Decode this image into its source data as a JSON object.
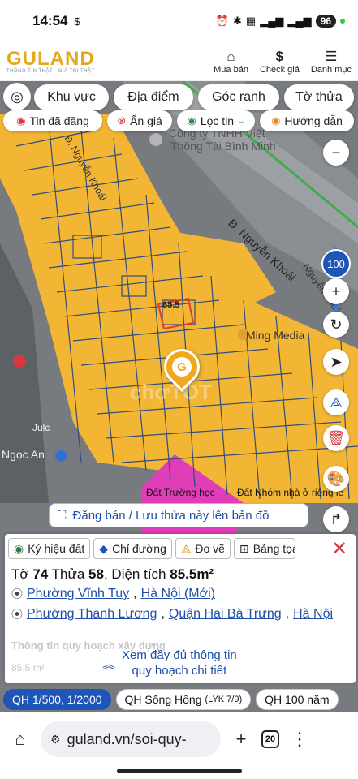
{
  "status": {
    "time": "14:54",
    "battery": "96"
  },
  "header": {
    "logo": "GULAND",
    "tagline": "THÔNG TIN THẬT - GIÁ TRỊ THẬT",
    "buy_label": "Mua bán",
    "price_label": "Check giá",
    "menu_label": "Danh mục"
  },
  "filters": {
    "row1": [
      "Khu vực",
      "Địa điểm",
      "Góc ranh",
      "Tờ thửa"
    ],
    "row2": [
      "Tin đã đăng",
      "Ẩn giá",
      "Lọc tin",
      "Hướng dẫn"
    ]
  },
  "map": {
    "zoom": "100",
    "labels": {
      "company": "Công ty TNHH Việt",
      "company2": "Thông Tài Bình Minh",
      "road1": "Đ. Nguyễn Khoái",
      "road2": "Đ. Nguyễn Khoái",
      "road3": "Nguyễn Khoái",
      "media": "Ming Media",
      "ngoc": "Ngọc An",
      "jul": "Julc",
      "school": "Đất Trường học",
      "nhaoriengle": "Đất Nhóm nhà ở riêng lẻ",
      "parcel": "85.5",
      "watermark": "chợTỐT"
    },
    "register_label": "Đăng bán / Lưu thửa này lên bản đồ"
  },
  "panel": {
    "tools": [
      "Ký hiệu đất",
      "Chỉ đường",
      "Đo vẽ",
      "Bảng tọa"
    ],
    "sheet_label": "Tờ",
    "sheet": "74",
    "plot_label": "Thửa",
    "plot": "58",
    "area_label": ", Diện tích",
    "area": "85.5m²",
    "addr1_ward": "Phường Vĩnh Tuy",
    "addr1_city": "Hà Nội (Mới)",
    "addr2_ward": "Phường Thanh Lương",
    "addr2_district": "Quận Hai Bà Trưng",
    "addr2_city": "Hà Nội",
    "faded_title": "Thông tin quy hoạch xây dựng",
    "faded_area": "85.5 m²",
    "more_line1": "Xem đầy đủ thông tin",
    "more_line2": "quy hoạch chi tiết"
  },
  "qh": {
    "item1": "QH 1/500, 1/2000",
    "item2": "QH Sông Hồng",
    "item2_sub": "(LYK 7/9)",
    "item3": "QH 100 năm"
  },
  "browser": {
    "url": "guland.vn/soi-quy-",
    "tabs": "20"
  }
}
